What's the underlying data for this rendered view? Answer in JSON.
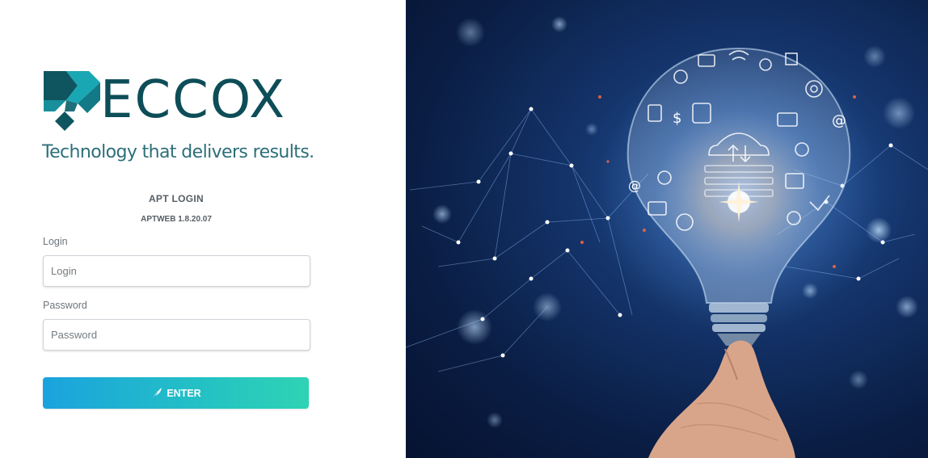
{
  "brand": {
    "name": "ECCOX",
    "tagline": "Technology that delivers results.",
    "colors": {
      "primary": "#0d4d57",
      "accent": "#2c6f79"
    }
  },
  "login": {
    "title": "APT LOGIN",
    "version": "APTWEB 1.8.20.07",
    "username_label": "Login",
    "username_placeholder": "Login",
    "username_value": "",
    "password_label": "Password",
    "password_placeholder": "Password",
    "password_value": "",
    "enter_label": "ENTER",
    "enter_icon": "feather-icon",
    "button_colors": {
      "start": "#1aa3de",
      "end": "#2fd3b4"
    }
  },
  "hero": {
    "icon": "lightbulb-network-illustration"
  }
}
